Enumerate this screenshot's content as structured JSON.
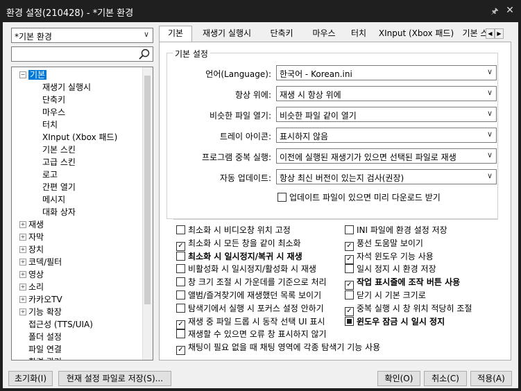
{
  "window": {
    "title": "환경 설정(210428) - *기본 환경",
    "pin_glyph": "🖈",
    "close_glyph": "✕"
  },
  "preset_combo": {
    "value": "*기본 환경"
  },
  "search": {
    "value": "",
    "placeholder": ""
  },
  "tree": {
    "selected": "기본",
    "items": [
      {
        "label": "기본",
        "level": 0,
        "expander": "−"
      },
      {
        "label": "재생기 실행시",
        "level": 1
      },
      {
        "label": "단축키",
        "level": 1
      },
      {
        "label": "마우스",
        "level": 1
      },
      {
        "label": "터치",
        "level": 1
      },
      {
        "label": "XInput (Xbox 패드)",
        "level": 1
      },
      {
        "label": "기본 스킨",
        "level": 1
      },
      {
        "label": "고급 스킨",
        "level": 1
      },
      {
        "label": "로고",
        "level": 1
      },
      {
        "label": "간편 열기",
        "level": 1
      },
      {
        "label": "메시지",
        "level": 1
      },
      {
        "label": "대화 상자",
        "level": 1
      },
      {
        "label": "재생",
        "level": 0,
        "expander": "+"
      },
      {
        "label": "자막",
        "level": 0,
        "expander": "+"
      },
      {
        "label": "장치",
        "level": 0,
        "expander": "+"
      },
      {
        "label": "코덱/필터",
        "level": 0,
        "expander": "+"
      },
      {
        "label": "영상",
        "level": 0,
        "expander": "+"
      },
      {
        "label": "소리",
        "level": 0,
        "expander": "+"
      },
      {
        "label": "카카오TV",
        "level": 0,
        "expander": "+"
      },
      {
        "label": "기능 확장",
        "level": 0,
        "expander": "+"
      },
      {
        "label": "접근성 (TTS/UIA)",
        "level": 0
      },
      {
        "label": "폴더 설정",
        "level": 0
      },
      {
        "label": "파일 연결",
        "level": 0
      },
      {
        "label": "환경 관리",
        "level": 0
      }
    ]
  },
  "tabs": [
    {
      "label": "기본",
      "active": true
    },
    {
      "label": "재생기 실행시"
    },
    {
      "label": "단축키"
    },
    {
      "label": "마우스"
    },
    {
      "label": "터치"
    },
    {
      "label": "XInput (Xbox 패드)"
    },
    {
      "label": "기본 스"
    }
  ],
  "tab_arrows": {
    "left": "◀",
    "right": "▶"
  },
  "basic": {
    "group_title": "기본 설정",
    "rows": [
      {
        "label": "언어(Language):",
        "value": "한국어 - Korean.ini"
      },
      {
        "label": "항상 위에:",
        "value": "재생 시 항상 위에"
      },
      {
        "label": "비슷한 파일 열기:",
        "value": "비슷한 파일 같이 열기"
      },
      {
        "label": "트레이 아이콘:",
        "value": "표시하지 않음"
      },
      {
        "label": "프로그램 중복 실행:",
        "value": "이전에 실행된 재생기가 있으면 선택된 파일로 재생"
      },
      {
        "label": "자동 업데이트:",
        "value": "항상 최신 버전이 있는지 검사(권장)"
      }
    ],
    "update_check": {
      "label": "업데이트 파일이 있으면 미리 다운로드 받기",
      "checked": false
    }
  },
  "options_left": [
    {
      "label": "최소화 시 비디오창 위치 고정",
      "state": "off"
    },
    {
      "label": "최소화 시 모든 창을 같이 최소화",
      "state": "on"
    },
    {
      "label": "최소화 시 일시정지/복귀 시 재생",
      "state": "off",
      "bold": true
    },
    {
      "label": "비활성화 시 일시정지/활성화 시 재생",
      "state": "off"
    },
    {
      "label": "창 크기 조절 시 가운데를 기준으로 처리",
      "state": "off"
    },
    {
      "label": "앨범/즐겨찾기에 재생했던 목록 보이기",
      "state": "off"
    },
    {
      "label": "탐색기에서 실행 시 포커스 설정 안하기",
      "state": "off"
    },
    {
      "label": "재생 중 파일 드롭 시 동작 선택 UI 표시",
      "state": "on"
    },
    {
      "label": "재생할 수 있으면 오류 창 표시하지 않기",
      "state": "off"
    },
    {
      "label": "채팅이 필요 없을 때 채팅 영역에 각종 탐색기 기능 사용",
      "state": "on"
    }
  ],
  "options_right": [
    {
      "label": "INI 파일에 환경 설정 저장",
      "state": "off"
    },
    {
      "label": "풍선 도움말 보이기",
      "state": "on"
    },
    {
      "label": "자석 윈도우 기능 사용",
      "state": "on"
    },
    {
      "label": "일시 정지 시 환경 저장",
      "state": "off"
    },
    {
      "label": "작업 표시줄에 조작 버튼 사용",
      "state": "on",
      "bold": true
    },
    {
      "label": "닫기 시 기본 크기로",
      "state": "off"
    },
    {
      "label": "중복 실행 시 창 위치 적당히 조절",
      "state": "on"
    },
    {
      "label": "윈도우 잠금 시 일시 정지",
      "state": "indeterminate",
      "bold": true
    }
  ],
  "buttons": {
    "reset": "초기화(I)",
    "save_current": "현재 설정 파일로 저장(S)...",
    "ok": "확인(O)",
    "cancel": "취소(C)",
    "apply": "적용(A)"
  },
  "icons": {
    "dropdown": "∨",
    "check": "✓"
  }
}
